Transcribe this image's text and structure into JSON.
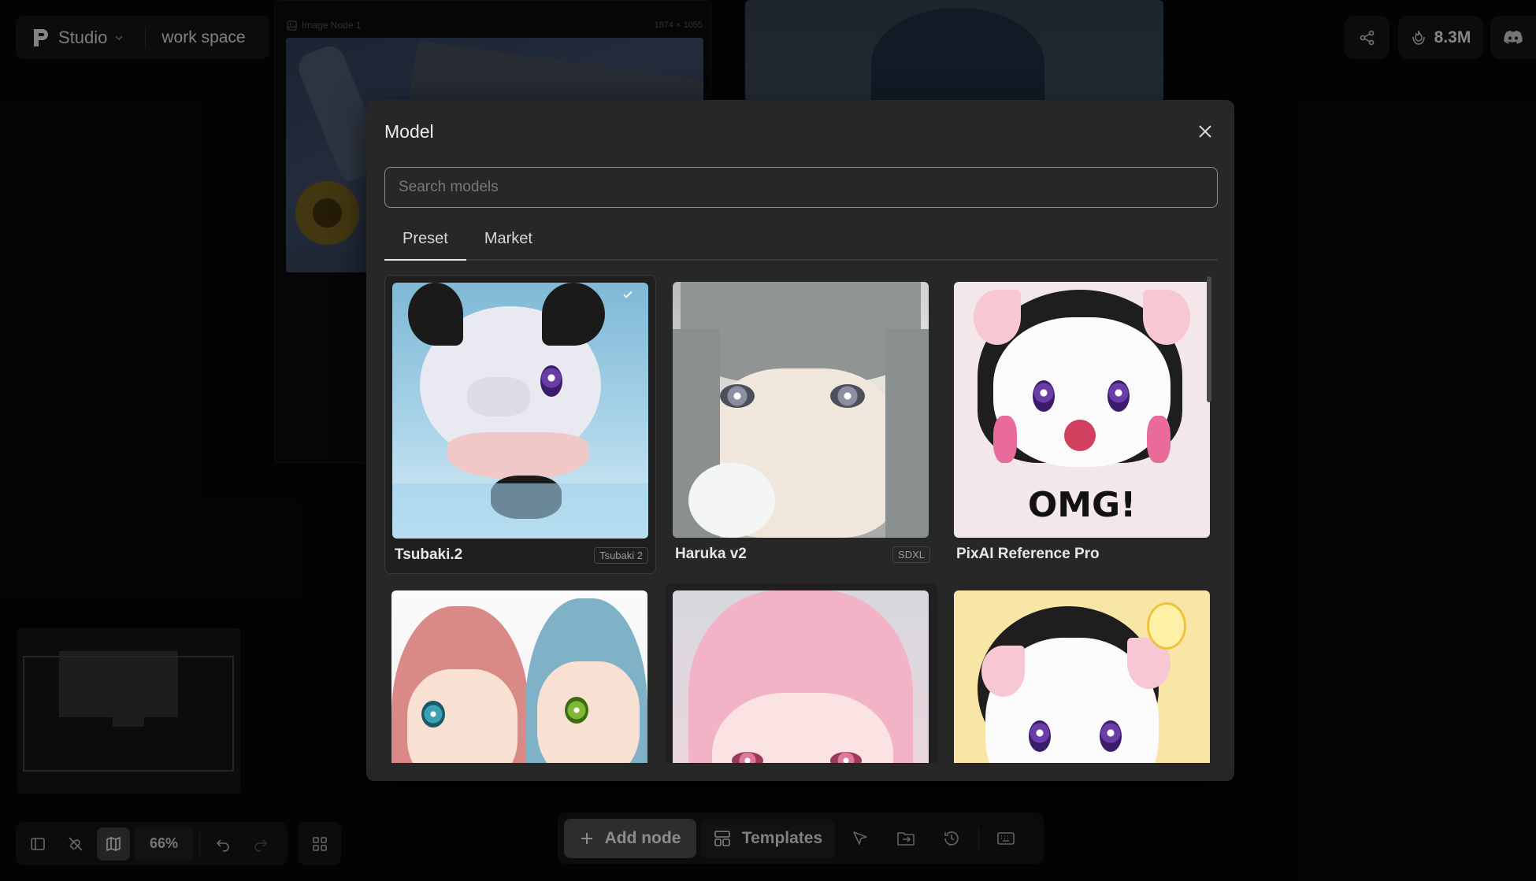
{
  "header": {
    "app_name": "Studio",
    "workspace": "work space",
    "credits": "8.3M"
  },
  "canvas": {
    "node_label": "Image Node 1",
    "node_dims": "1874 × 1055"
  },
  "modal": {
    "title": "Model",
    "search_placeholder": "Search models",
    "tabs": [
      {
        "label": "Preset",
        "active": true
      },
      {
        "label": "Market",
        "active": false
      }
    ],
    "models": [
      {
        "name": "Tsubaki.2",
        "tag": "Tsubaki 2",
        "selected": true
      },
      {
        "name": "Haruka v2",
        "tag": "SDXL",
        "selected": false
      },
      {
        "name": "PixAI Reference Pro",
        "tag": "",
        "selected": false,
        "thumb_text": "OMG!"
      },
      {
        "name": "",
        "tag": "",
        "selected": false
      },
      {
        "name": "",
        "tag": "",
        "selected": false
      },
      {
        "name": "",
        "tag": "",
        "selected": false
      }
    ]
  },
  "toolbar": {
    "zoom": "66%",
    "add_node": "Add node",
    "templates": "Templates"
  },
  "icons": {
    "logo": "pixai-logo-icon",
    "share": "share-icon",
    "credits": "credits-icon",
    "discord": "discord-icon",
    "close": "close-icon",
    "check": "check-icon"
  }
}
